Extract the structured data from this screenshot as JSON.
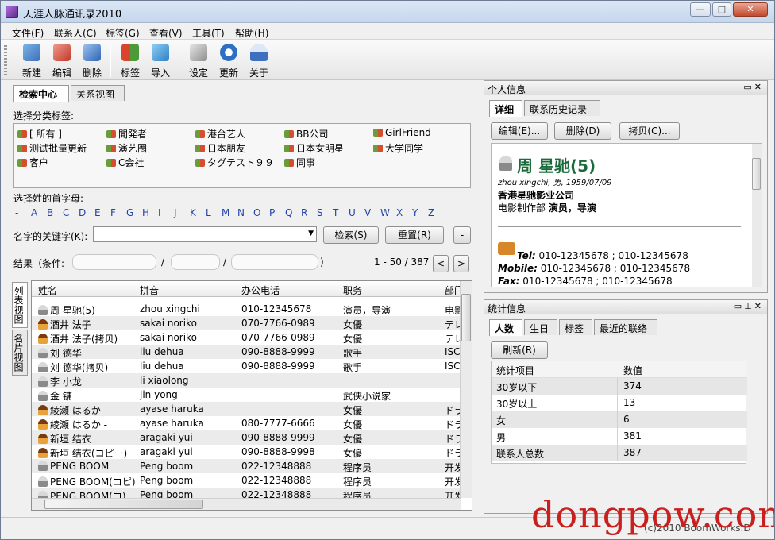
{
  "window": {
    "title": "天涯人脉通讯录2010",
    "controls": [
      "—",
      "□",
      "✕"
    ]
  },
  "menu": [
    "文件(F)",
    "联系人(C)",
    "标签(G)",
    "查看(V)",
    "工具(T)",
    "帮助(H)"
  ],
  "toolbar": [
    "新建",
    "编辑",
    "删除",
    "标签",
    "导入",
    "设定",
    "更新",
    "关于"
  ],
  "left": {
    "tabs": [
      "检索中心",
      "关系视图"
    ],
    "tag_section_label": "选择分类标签:",
    "tags": [
      [
        "[ 所有 ]",
        "開発者",
        "港台艺人",
        "BB公司",
        "GirlFriend"
      ],
      [
        "测试批量更新",
        "演艺圈",
        "日本朋友",
        "日本女明星",
        "大学同学"
      ],
      [
        "客户",
        "C会社",
        "タグテスト９９",
        "同事"
      ]
    ],
    "initial_label": "选择姓的首字母:",
    "letters": [
      "-",
      "A",
      "B",
      "C",
      "D",
      "E",
      "F",
      "G",
      "H",
      "I",
      "J",
      "K",
      "L",
      "M",
      "N",
      "O",
      "P",
      "Q",
      "R",
      "S",
      "T",
      "U",
      "V",
      "W",
      "X",
      "Y",
      "Z"
    ],
    "keyword_label": "名字的关键字(K):",
    "search_button": "检索(S)",
    "reset_button": "重置(R)",
    "minus_button": "-",
    "result_label": "结果（条件:",
    "result_sep1": "/",
    "result_sep2": "/",
    "result_close": ")",
    "result_range": "1 - 50 / 387",
    "prev": "<",
    "next": ">",
    "vtabs": [
      "列表视图",
      "名片视图"
    ],
    "columns": [
      "姓名",
      "拼音",
      "办公电话",
      "职务",
      "部门"
    ],
    "rows": [
      {
        "icon": "m",
        "name": "周 星驰(5)",
        "pinyin": "zhou xingchi",
        "phone": "010-12345678",
        "title": "演员，导演",
        "dept": "电影"
      },
      {
        "icon": "f",
        "name": "酒井 法子",
        "pinyin": "sakai noriko",
        "phone": "070-7766-0989",
        "title": "女優",
        "dept": "テレ"
      },
      {
        "icon": "f",
        "name": "酒井 法子(拷贝)",
        "pinyin": "sakai noriko",
        "phone": "070-7766-0989",
        "title": "女優",
        "dept": "テレ"
      },
      {
        "icon": "m",
        "name": "刘 德华",
        "pinyin": "liu dehua",
        "phone": "090-8888-9999",
        "title": "歌手",
        "dept": "ISC"
      },
      {
        "icon": "m",
        "name": "刘 德华(拷贝)",
        "pinyin": "liu dehua",
        "phone": "090-8888-9999",
        "title": "歌手",
        "dept": "ISC"
      },
      {
        "icon": "m",
        "name": "李 小龙",
        "pinyin": "li xiaolong",
        "phone": "",
        "title": "",
        "dept": ""
      },
      {
        "icon": "m",
        "name": "金 镛",
        "pinyin": "jin yong",
        "phone": "",
        "title": "武侠小说家",
        "dept": ""
      },
      {
        "icon": "f",
        "name": "綾瀬 はるか",
        "pinyin": "ayase haruka",
        "phone": "",
        "title": "女優",
        "dept": "ドラ"
      },
      {
        "icon": "f",
        "name": "綾瀬 はるか -",
        "pinyin": "ayase haruka",
        "phone": "080-7777-6666",
        "title": "女優",
        "dept": "ドラ"
      },
      {
        "icon": "f",
        "name": "新垣 结衣",
        "pinyin": "aragaki yui",
        "phone": "090-8888-9999",
        "title": "女優",
        "dept": "ドラ"
      },
      {
        "icon": "f",
        "name": "新垣 结衣(コピー)",
        "pinyin": "aragaki yui",
        "phone": "090-8888-9998",
        "title": "女優",
        "dept": "ドラ"
      },
      {
        "icon": "m",
        "name": "PENG BOOM",
        "pinyin": "Peng boom",
        "phone": "022-12348888",
        "title": "程序员",
        "dept": "开发"
      },
      {
        "icon": "m",
        "name": "PENG BOOM(コピ)",
        "pinyin": "Peng boom",
        "phone": "022-12348888",
        "title": "程序员",
        "dept": "开发"
      },
      {
        "icon": "m",
        "name": "PENG BOOM(コ)",
        "pinyin": "Peng boom",
        "phone": "022-12348888",
        "title": "程序员",
        "dept": "开发"
      }
    ]
  },
  "profile": {
    "panel_title": "个人信息",
    "tabs": [
      "详细",
      "联系历史记录"
    ],
    "edit": "编辑(E)...",
    "delete": "删除(D)",
    "copy": "拷贝(C)...",
    "name": "周 星驰(5)",
    "sub": "zhou xingchi, 男, 1959/07/09",
    "company": "香港星驰影业公司",
    "dept_prefix": "电影制作部",
    "role": "演员，导演",
    "tel_label": "Tel:",
    "tel": "010-12345678 ; 010-12345678",
    "mobile_label": "Mobile:",
    "mobile": "010-12345678 ; 010-12345678",
    "fax_label": "Fax:",
    "fax": "010-12345678 ; 010-12345678"
  },
  "stats": {
    "panel_title": "统计信息",
    "tabs": [
      "人数",
      "生日",
      "标签",
      "最近的联络"
    ],
    "refresh": "刷新(R)",
    "col_item": "统计项目",
    "col_value": "数值",
    "rows": [
      {
        "item": "30岁以下",
        "value": "374"
      },
      {
        "item": "30岁以上",
        "value": "13"
      },
      {
        "item": "女",
        "value": "6"
      },
      {
        "item": "男",
        "value": "381"
      },
      {
        "item": "联系人总数",
        "value": "387"
      }
    ]
  },
  "status": {
    "copyright": "(c)2010 BoomWorks.D",
    "watermark": "dongpow.com"
  },
  "colors": {
    "accent_name": "#1a6b3c",
    "watermark": "#c8201e",
    "letter": "#2244aa"
  }
}
